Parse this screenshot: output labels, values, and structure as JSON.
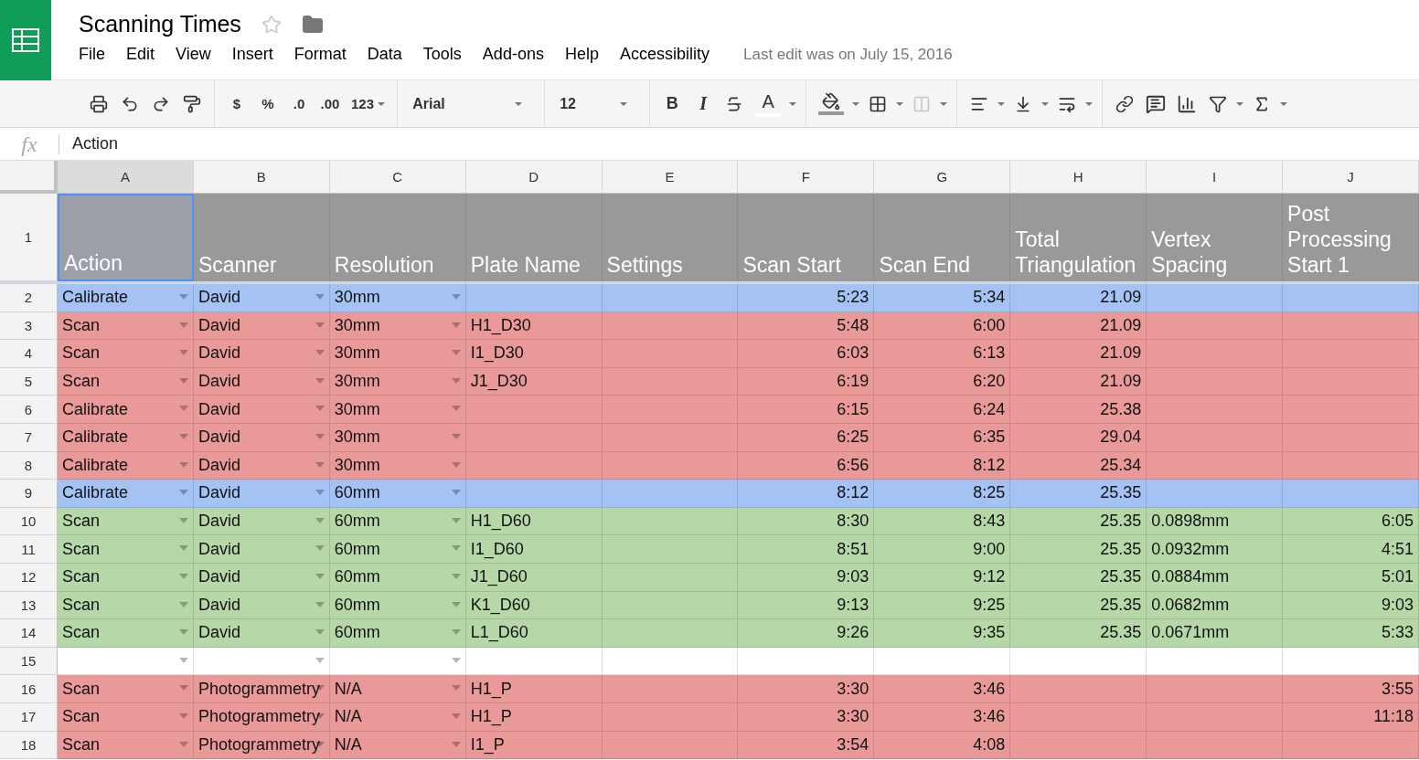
{
  "document": {
    "title": "Scanning Times",
    "starred": false,
    "last_edit": "Last edit was on July 15, 2016"
  },
  "menu": [
    "File",
    "Edit",
    "View",
    "Insert",
    "Format",
    "Data",
    "Tools",
    "Add-ons",
    "Help",
    "Accessibility"
  ],
  "toolbar": {
    "currency": "$",
    "percent": "%",
    "decrease_decimals": ".0",
    "increase_decimals": ".00",
    "number_format": "123",
    "font": "Arial",
    "font_size": "12",
    "bold": "B",
    "italic": "I",
    "text_color": "A",
    "merge_disabled": true
  },
  "formula_bar": {
    "label": "fx",
    "value": "Action"
  },
  "columns": [
    {
      "label": "A",
      "selected": true,
      "kind": "text",
      "dropdown": true
    },
    {
      "label": "B",
      "selected": false,
      "kind": "text",
      "dropdown": true
    },
    {
      "label": "C",
      "selected": false,
      "kind": "text",
      "dropdown": true
    },
    {
      "label": "D",
      "selected": false,
      "kind": "text",
      "dropdown": false
    },
    {
      "label": "E",
      "selected": false,
      "kind": "text",
      "dropdown": false
    },
    {
      "label": "F",
      "selected": false,
      "kind": "number",
      "dropdown": false
    },
    {
      "label": "G",
      "selected": false,
      "kind": "number",
      "dropdown": false
    },
    {
      "label": "H",
      "selected": false,
      "kind": "number",
      "dropdown": false
    },
    {
      "label": "I",
      "selected": false,
      "kind": "text",
      "dropdown": false
    },
    {
      "label": "J",
      "selected": false,
      "kind": "number",
      "dropdown": false
    }
  ],
  "header_row": {
    "number": "1",
    "cells": [
      {
        "text": "Action",
        "selected": true
      },
      {
        "text": "Scanner",
        "selected": false
      },
      {
        "text": "Resolution",
        "selected": false
      },
      {
        "text": "Plate Name",
        "selected": false
      },
      {
        "text": "Settings",
        "selected": false
      },
      {
        "text": "Scan Start",
        "selected": false
      },
      {
        "text": "Scan End",
        "selected": false
      },
      {
        "text": "Total Triangulation",
        "selected": false
      },
      {
        "text": "Vertex Spacing",
        "selected": false
      },
      {
        "text": "Post Processing Start 1",
        "selected": false
      }
    ]
  },
  "rows": [
    {
      "number": "2",
      "color": "#a4c2f4",
      "cells": [
        "Calibrate",
        "David",
        "30mm",
        null,
        null,
        "5:23",
        "5:34",
        "21.09",
        null,
        null
      ]
    },
    {
      "number": "3",
      "color": "#ea9999",
      "cells": [
        "Scan",
        "David",
        "30mm",
        "H1_D30",
        null,
        "5:48",
        "6:00",
        "21.09",
        null,
        null
      ]
    },
    {
      "number": "4",
      "color": "#ea9999",
      "cells": [
        "Scan",
        "David",
        "30mm",
        "I1_D30",
        null,
        "6:03",
        "6:13",
        "21.09",
        null,
        null
      ]
    },
    {
      "number": "5",
      "color": "#ea9999",
      "cells": [
        "Scan",
        "David",
        "30mm",
        "J1_D30",
        null,
        "6:19",
        "6:20",
        "21.09",
        null,
        null
      ]
    },
    {
      "number": "6",
      "color": "#ea9999",
      "cells": [
        "Calibrate",
        "David",
        "30mm",
        null,
        null,
        "6:15",
        "6:24",
        "25.38",
        null,
        null
      ]
    },
    {
      "number": "7",
      "color": "#ea9999",
      "cells": [
        "Calibrate",
        "David",
        "30mm",
        null,
        null,
        "6:25",
        "6:35",
        "29.04",
        null,
        null
      ]
    },
    {
      "number": "8",
      "color": "#ea9999",
      "cells": [
        "Calibrate",
        "David",
        "30mm",
        null,
        null,
        "6:56",
        "8:12",
        "25.34",
        null,
        null
      ]
    },
    {
      "number": "9",
      "color": "#a4c2f4",
      "cells": [
        "Calibrate",
        "David",
        "60mm",
        null,
        null,
        "8:12",
        "8:25",
        "25.35",
        null,
        null
      ]
    },
    {
      "number": "10",
      "color": "#b6d7a8",
      "cells": [
        "Scan",
        "David",
        "60mm",
        "H1_D60",
        null,
        "8:30",
        "8:43",
        "25.35",
        "0.0898mm",
        "6:05"
      ]
    },
    {
      "number": "11",
      "color": "#b6d7a8",
      "cells": [
        "Scan",
        "David",
        "60mm",
        "I1_D60",
        null,
        "8:51",
        "9:00",
        "25.35",
        "0.0932mm",
        "4:51"
      ]
    },
    {
      "number": "12",
      "color": "#b6d7a8",
      "cells": [
        "Scan",
        "David",
        "60mm",
        "J1_D60",
        null,
        "9:03",
        "9:12",
        "25.35",
        "0.0884mm",
        "5:01"
      ]
    },
    {
      "number": "13",
      "color": "#b6d7a8",
      "cells": [
        "Scan",
        "David",
        "60mm",
        "K1_D60",
        null,
        "9:13",
        "9:25",
        "25.35",
        "0.0682mm",
        "9:03"
      ]
    },
    {
      "number": "14",
      "color": "#b6d7a8",
      "cells": [
        "Scan",
        "David",
        "60mm",
        "L1_D60",
        null,
        "9:26",
        "9:35",
        "25.35",
        "0.0671mm",
        "5:33"
      ]
    },
    {
      "number": "15",
      "color": "#ffffff",
      "cells": [
        null,
        null,
        null,
        null,
        null,
        null,
        null,
        null,
        null,
        null
      ]
    },
    {
      "number": "16",
      "color": "#ea9999",
      "cells": [
        "Scan",
        "Photogrammetry",
        "N/A",
        "H1_P",
        null,
        "3:30",
        "3:46",
        null,
        null,
        "3:55"
      ]
    },
    {
      "number": "17",
      "color": "#ea9999",
      "cells": [
        "Scan",
        "Photogrammetry",
        "N/A",
        "H1_P",
        null,
        "3:30",
        "3:46",
        null,
        null,
        "11:18"
      ]
    },
    {
      "number": "18",
      "color": "#ea9999",
      "cells": [
        "Scan",
        "Photogrammetry",
        "N/A",
        "I1_P",
        null,
        "3:54",
        "4:08",
        null,
        null,
        null
      ]
    }
  ]
}
